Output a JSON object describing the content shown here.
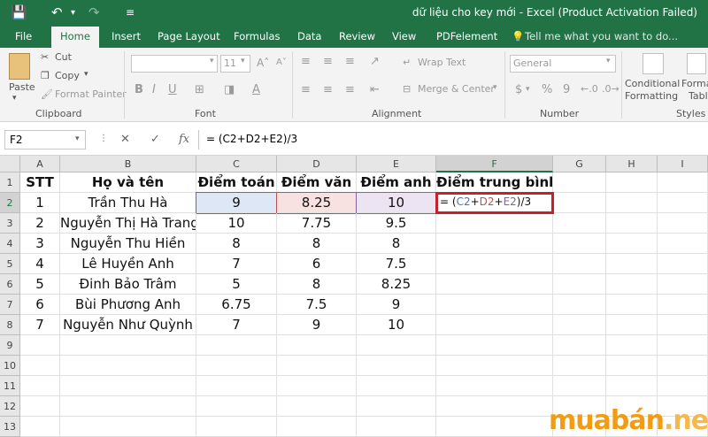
{
  "app": {
    "title": "dữ liệu cho key mới - Excel (Product Activation Failed)"
  },
  "tabs": [
    "File",
    "Home",
    "Insert",
    "Page Layout",
    "Formulas",
    "Data",
    "Review",
    "View",
    "PDFelement"
  ],
  "tell_me": "Tell me what you want to do...",
  "ribbon": {
    "paste": "Paste",
    "cut": "Cut",
    "copy": "Copy",
    "format_painter": "Format Painter",
    "clipboard": "Clipboard",
    "font_size": "11",
    "font": "Font",
    "wrap_text": "Wrap Text",
    "merge_center": "Merge & Center",
    "alignment": "Alignment",
    "number_format": "General",
    "number": "Number",
    "conditional_formatting_1": "Conditional",
    "conditional_formatting_2": "Formatting",
    "format_as_table_1": "Forma",
    "format_as_table_2": "Table",
    "styles": "Styles",
    "currency": "$",
    "percent": "%",
    "comma": "9"
  },
  "formula_bar": {
    "name_box": "F2",
    "fx": "fx",
    "formula": "= (C2+D2+E2)/3"
  },
  "columns": [
    "A",
    "B",
    "C",
    "D",
    "E",
    "F",
    "G",
    "H",
    "I"
  ],
  "rows": [
    "1",
    "2",
    "3",
    "4",
    "5",
    "6",
    "7",
    "8",
    "9",
    "10",
    "11",
    "12",
    "13"
  ],
  "sheet": {
    "header": [
      "STT",
      "Họ và tên",
      "Điểm toán",
      "Điểm văn",
      "Điểm anh",
      "Điểm trung bình"
    ],
    "data": [
      [
        "1",
        "Trần Thu Hà",
        "9",
        "8.25",
        "10"
      ],
      [
        "2",
        "Nguyễn Thị Hà Trang",
        "10",
        "7.75",
        "9.5"
      ],
      [
        "3",
        "Nguyễn Thu Hiền",
        "8",
        "8",
        "8"
      ],
      [
        "4",
        "Lê Huyền Anh",
        "7",
        "6",
        "7.5"
      ],
      [
        "5",
        "Đinh Bảo Trâm",
        "5",
        "8",
        "8.25"
      ],
      [
        "6",
        "Bùi Phương Anh",
        "6.75",
        "7.5",
        "9"
      ],
      [
        "7",
        "Nguyễn Như Quỳnh",
        "7",
        "9",
        "10"
      ]
    ],
    "active_cell_text": {
      "prefix": "= (",
      "c": "C2",
      "plus1": "+",
      "d": "D2",
      "plus2": "+",
      "e": "E2",
      "suffix": ")/3"
    }
  },
  "watermark": {
    "part1": "muabán",
    "part2": ".net"
  },
  "colors": {
    "excel_green": "#217346",
    "ref_c": "#4472c4",
    "ref_d": "#c0504d",
    "ref_e": "#8064a2",
    "active_border": "#c8202a"
  }
}
